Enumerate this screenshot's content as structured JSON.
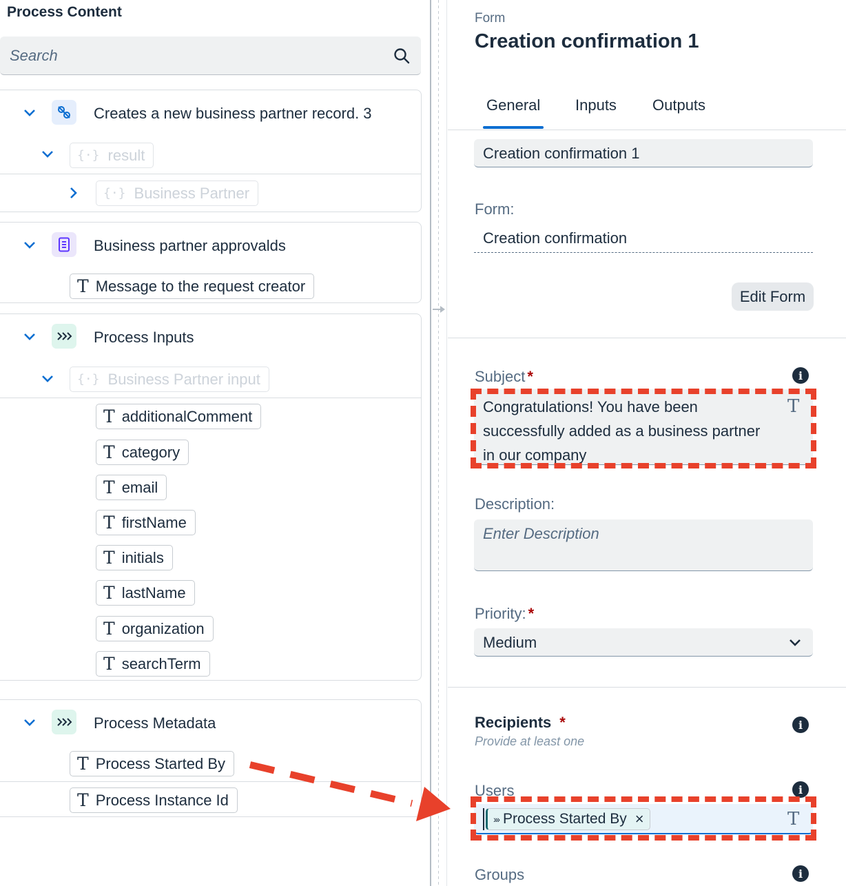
{
  "left": {
    "title": "Process Content",
    "search_placeholder": "Search",
    "groups": [
      {
        "label": "Creates a new business partner record. 3",
        "icon": "action-icon",
        "result_label": "result",
        "business_partner_label": "Business Partner"
      },
      {
        "label": "Business partner approvalds",
        "icon": "form-icon",
        "items": [
          "Message to the request creator"
        ]
      },
      {
        "label": "Process Inputs",
        "icon": "process-input-icon",
        "input_label": "Business Partner input",
        "items": [
          "additionalComment",
          "category",
          "email",
          "firstName",
          "initials",
          "lastName",
          "organization",
          "searchTerm"
        ]
      },
      {
        "label": "Process Metadata",
        "icon": "process-metadata-icon",
        "items": [
          "Process Started By",
          "Process Instance Id"
        ]
      }
    ]
  },
  "right": {
    "type_label": "Form",
    "title": "Creation confirmation 1",
    "tabs": [
      "General",
      "Inputs",
      "Outputs"
    ],
    "active_tab": "General",
    "name_value": "Creation confirmation 1",
    "form_label": "Form:",
    "form_value": "Creation confirmation",
    "edit_form_button": "Edit Form",
    "subject_label": "Subject",
    "subject_lines": [
      "Congratulations! You have been",
      "successfully added as a business partner",
      "in our company"
    ],
    "description_label": "Description:",
    "description_placeholder": "Enter Description",
    "priority_label": "Priority:",
    "priority_value": "Medium",
    "recipients_label": "Recipients",
    "recipients_hint": "Provide at least one",
    "users_label": "Users",
    "users_token": "Process Started By",
    "groups_label": "Groups",
    "required_mark": "*"
  },
  "colors": {
    "accent": "#0a6ed1",
    "highlight": "#e8412b",
    "required": "#aa0808"
  }
}
